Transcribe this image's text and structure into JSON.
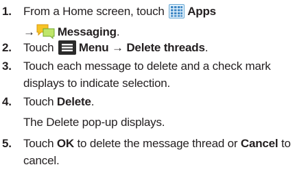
{
  "steps": [
    {
      "num": "1.",
      "line1_pre": "From a Home screen, touch ",
      "apps_label": "Apps",
      "arrow": "→",
      "messaging_label": "Messaging",
      "line2_post": "."
    },
    {
      "num": "2.",
      "pre": "Touch ",
      "menu_label": "Menu",
      "arrow": "→",
      "action": "Delete threads",
      "post": "."
    },
    {
      "num": "3.",
      "line1": "Touch each message to delete and a check mark",
      "line2": "displays to indicate selection."
    },
    {
      "num": "4.",
      "pre": "Touch ",
      "action": "Delete",
      "post": ".",
      "note": "The Delete pop-up displays."
    },
    {
      "num": "5.",
      "pre": "Touch ",
      "ok": "OK",
      "mid": " to delete the message thread or ",
      "cancel": "Cancel",
      "post": " to",
      "line2": "cancel."
    }
  ],
  "icons": {
    "apps": "apps-grid-icon",
    "messaging": "messaging-icon",
    "menu": "menu-icon"
  }
}
